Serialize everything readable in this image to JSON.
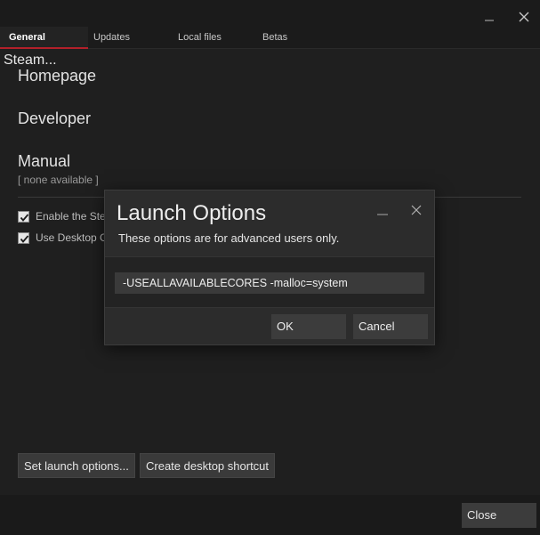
{
  "window": {
    "minimize_glyph": "minimize-icon",
    "close_glyph": "close-icon"
  },
  "tabs": [
    {
      "label": "General",
      "active": true
    },
    {
      "label": "Updates",
      "active": false
    },
    {
      "label": "Local files",
      "active": false
    },
    {
      "label": "Betas",
      "active": false
    }
  ],
  "general": {
    "steam_label": "Steam...",
    "homepage": "Homepage",
    "developer": "Developer",
    "manual": "Manual",
    "manual_status": "[ none available ]",
    "options": [
      {
        "label": "Enable the Steam Overlay while in-game",
        "checked": true
      },
      {
        "label": "Use Desktop Game Theatre while SteamVR is active",
        "checked": true
      }
    ],
    "set_launch_options_label": "Set launch options...",
    "create_shortcut_label": "Create desktop shortcut"
  },
  "footer": {
    "close_label": "Close"
  },
  "dialog": {
    "title": "Launch Options",
    "subtitle": "These options are for advanced users only.",
    "input_value": "-USEALLAVAILABLECORES -malloc=system",
    "ok_label": "OK",
    "cancel_label": "Cancel"
  },
  "colors": {
    "active_tab_underline": "#b3202a",
    "background": "#1f1f1f",
    "dialog_background": "#2c2c2c"
  }
}
